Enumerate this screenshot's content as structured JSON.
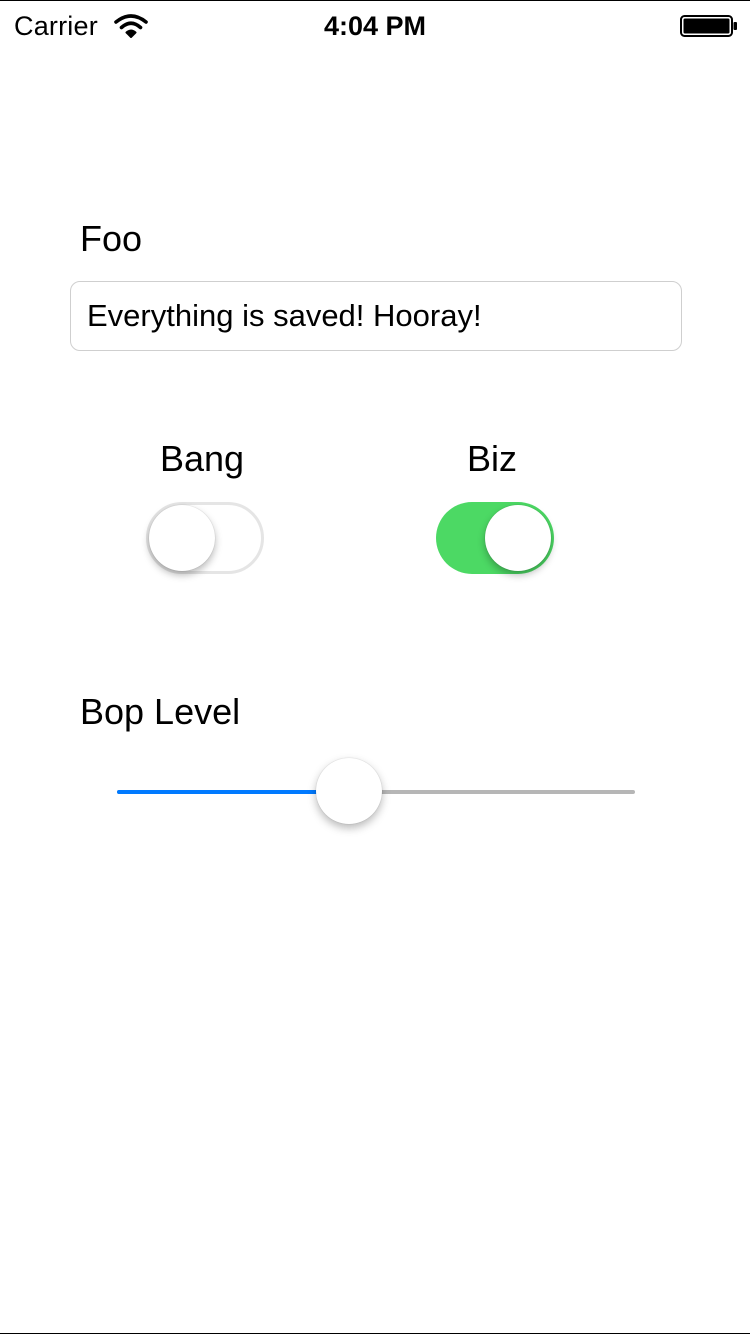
{
  "status_bar": {
    "carrier": "Carrier",
    "time": "4:04 PM",
    "signal_icon": "wifi-icon",
    "battery_icon": "battery-full-icon"
  },
  "form": {
    "foo": {
      "label": "Foo",
      "value": "Everything is saved! Hooray!"
    },
    "bang": {
      "label": "Bang",
      "on": false
    },
    "biz": {
      "label": "Biz",
      "on": true
    },
    "bop_level": {
      "label": "Bop Level",
      "value_fraction": 0.44
    }
  },
  "colors": {
    "switch_on": "#4cd964",
    "slider_fill": "#007aff",
    "slider_track": "#b6b6b6"
  }
}
